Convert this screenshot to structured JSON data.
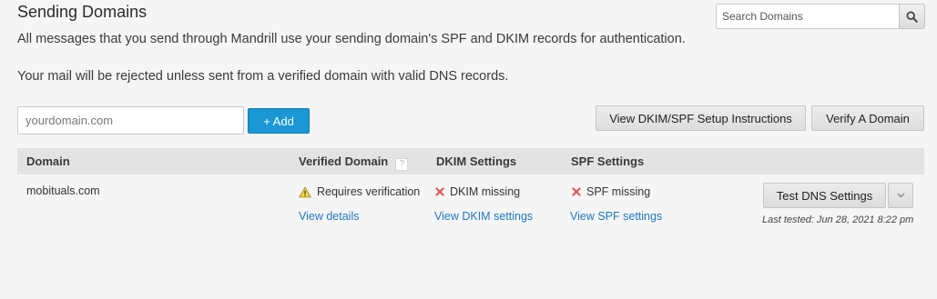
{
  "page": {
    "title": "Sending Domains",
    "description_1": "All messages that you send through Mandrill use your sending domain's SPF and DKIM records for authentication.",
    "description_2": "Your mail will be rejected unless sent from a verified domain with valid DNS records."
  },
  "search": {
    "placeholder": "Search Domains",
    "icon": "search-icon"
  },
  "add_form": {
    "placeholder": "yourdomain.com",
    "add_label": "+ Add"
  },
  "actions": {
    "instructions_label": "View DKIM/SPF Setup Instructions",
    "verify_label": "Verify A Domain"
  },
  "table": {
    "columns": {
      "domain": "Domain",
      "verified": "Verified Domain",
      "verified_help": "?",
      "dkim": "DKIM Settings",
      "spf": "SPF Settings"
    },
    "rows": [
      {
        "domain": "mobituals.com",
        "verified_status": "Requires verification",
        "verified_link": "View details",
        "dkim_status": "DKIM missing",
        "dkim_link": "View DKIM settings",
        "spf_status": "SPF missing",
        "spf_link": "View SPF settings",
        "test_label": "Test DNS Settings",
        "last_tested": "Last tested: Jun 28, 2021 8:22 pm"
      }
    ]
  },
  "icons": {
    "warning": "warning-icon",
    "error": "x-icon",
    "dropdown": "chevron-down-icon"
  },
  "colors": {
    "accent": "#1a97d4",
    "link": "#1e7bbf",
    "error": "#e05555",
    "warning": "#e5c227",
    "header_bg": "#e3e3e3",
    "page_bg": "#f5f5f5"
  }
}
